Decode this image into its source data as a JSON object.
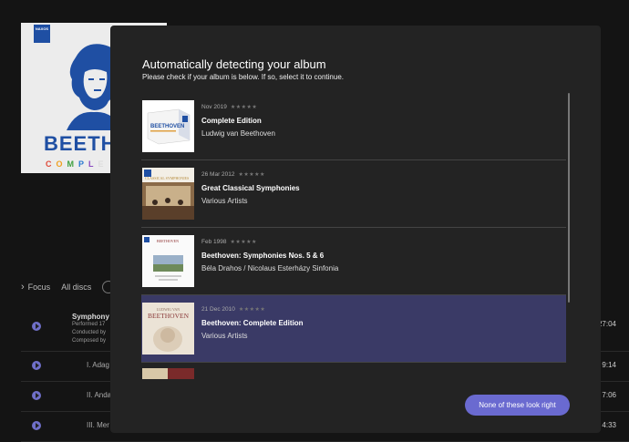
{
  "background": {
    "cover": {
      "publisher": "NAXOS",
      "title_visible": "BEETHO",
      "subtitle_visible": "COMPLETE E"
    },
    "toolbar": {
      "focus_label": "Focus",
      "discs_label": "All discs"
    },
    "tracks": [
      {
        "name": "Symphony N",
        "meta1": "Performed 17",
        "meta2": "Conducted by",
        "meta3": "Composed by",
        "duration": "27:04"
      },
      {
        "name": "I. Adag",
        "duration": "9:14"
      },
      {
        "name": "II. Anda",
        "duration": "7:06"
      },
      {
        "name": "III. Mer",
        "duration": "4:33"
      }
    ]
  },
  "modal": {
    "title": "Automatically detecting your album",
    "subtitle": "Please check if your album is below. If so, select it to continue.",
    "results": [
      {
        "date": "Nov 2019",
        "stars": "★★★★★",
        "title": "Complete Edition",
        "artist": "Ludwig van Beethoven",
        "selected": false,
        "thumb_text": "BEETHOVEN"
      },
      {
        "date": "26 Mar 2012",
        "stars": "★★★★★",
        "title": "Great Classical Symphonies",
        "artist": "Various Artists",
        "selected": false,
        "thumb_text": "CLASSICAL SYMPHONIES"
      },
      {
        "date": "Feb 1998",
        "stars": "★★★★★",
        "title": "Beethoven: Symphonies Nos. 5 & 6",
        "artist": "Béla Drahos / Nicolaus Esterházy Sinfonia",
        "selected": false,
        "thumb_text": "BEETHOVEN"
      },
      {
        "date": "21 Dec 2010",
        "stars": "★★★★★",
        "title": "Beethoven: Complete Edition",
        "artist": "Various Artists",
        "selected": true,
        "thumb_text_top": "LUDWIG VAN",
        "thumb_text": "BEETHOVEN"
      }
    ],
    "none_button": "None of these look right"
  },
  "colors": {
    "accent": "#6a6ad0",
    "selected_row": "#3a3a66",
    "modal_bg": "#232323"
  }
}
